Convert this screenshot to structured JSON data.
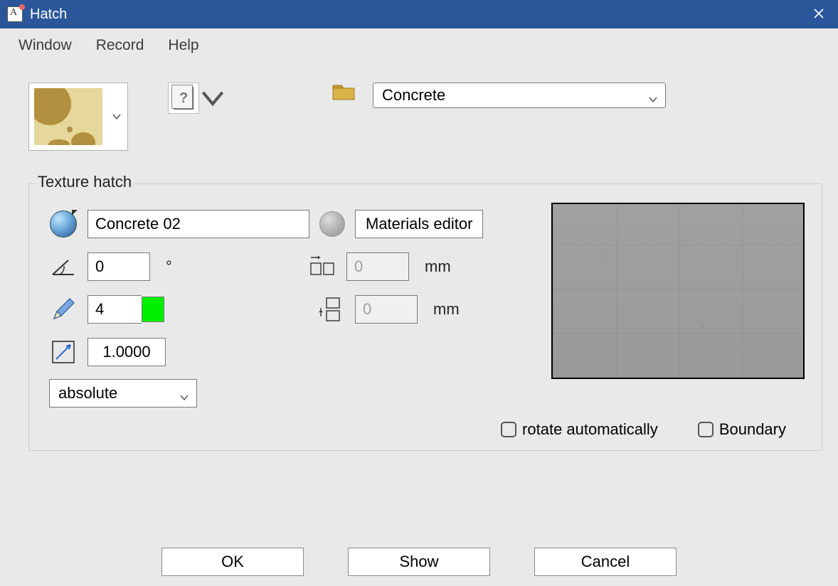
{
  "window": {
    "title": "Hatch"
  },
  "menu": {
    "window": "Window",
    "record": "Record",
    "help": "Help"
  },
  "category": {
    "selected": "Concrete"
  },
  "group": {
    "legend": "Texture hatch"
  },
  "fields": {
    "material_name": "Concrete 02",
    "materials_editor_btn": "Materials editor",
    "angle": "0",
    "angle_unit": "°",
    "width_offset": "0",
    "width_unit": "mm",
    "pen": "4",
    "height_offset": "0",
    "height_unit": "mm",
    "scale": "1.0000",
    "mode": "absolute"
  },
  "checkboxes": {
    "rotate": "rotate automatically",
    "boundary": "Boundary"
  },
  "buttons": {
    "ok": "OK",
    "show": "Show",
    "cancel": "Cancel"
  }
}
